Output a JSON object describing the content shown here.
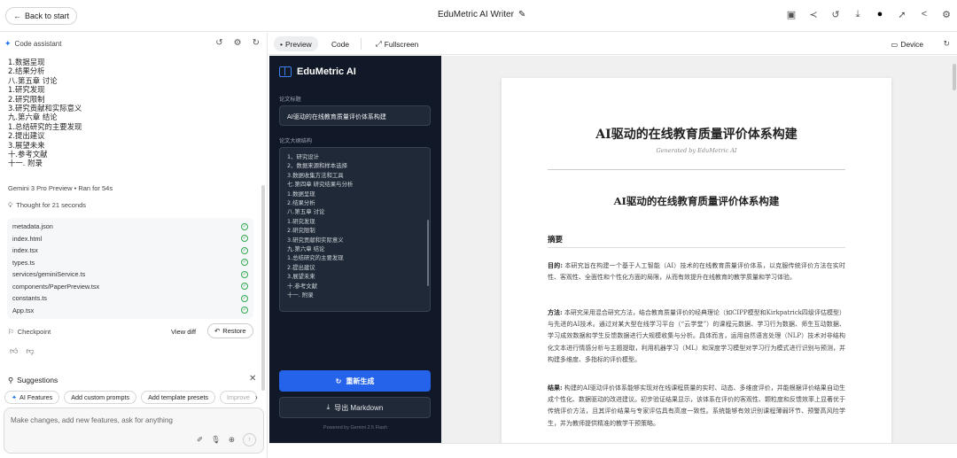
{
  "topbar": {
    "back_label": "Back to start",
    "app_title": "EduMetric AI Writer"
  },
  "assistant": {
    "header": "Code assistant",
    "outline_lines": [
      "1.数据呈现",
      "2.结果分析",
      "八.第五章 讨论",
      "1.研究发现",
      "2.研究限制",
      "3.研究贡献和实际意义",
      "九.第六章 结论",
      "1.总结研究的主要发现",
      "2.提出建议",
      "3.展望未来",
      "十.参考文献",
      "十一. 附录"
    ],
    "run_info": "Gemini 3 Pro Preview • Ran for 54s",
    "thought": "Thought for 21 seconds",
    "files": [
      "metadata.json",
      "index.html",
      "index.tsx",
      "types.ts",
      "services/geminiService.ts",
      "components/PaperPreview.tsx",
      "constants.ts",
      "App.tsx"
    ],
    "checkpoint_label": "Checkpoint",
    "view_diff_label": "View diff",
    "restore_label": "Restore",
    "suggestions_label": "Suggestions",
    "chips": [
      "AI Features",
      "Add custom prompts",
      "Add template presets",
      "Improve"
    ],
    "prompt_placeholder": "Make changes, add new features, ask for anything"
  },
  "preview_toolbar": {
    "preview_label": "Preview",
    "code_label": "Code",
    "fullscreen_label": "Fullscreen",
    "device_label": "Device"
  },
  "app": {
    "brand": "EduMetric AI",
    "title_label": "论文标题",
    "title_value": "AI驱动的在线教育质量评价体系构建",
    "outline_label": "论文大纲结构",
    "outline_lines": [
      "1、研究设计",
      "2、数据来源和样本选择",
      "3.数据收集方法和工具",
      "七.第四章 研究结果与分析",
      "1.数据呈现",
      "2.结果分析",
      "八.第五章 讨论",
      "1.研究发现",
      "2.研究限制",
      "3.研究贡献和实际意义",
      "九.第六章 结论",
      "1.总结研究的主要发现",
      "2.提出建议",
      "3.展望未来",
      "十.参考文献",
      "十一. 附录"
    ],
    "regen_label": "重新生成",
    "export_label": "导出 Markdown",
    "powered": "Powered by Gemini 2.5 Flash"
  },
  "paper": {
    "title": "AI驱动的在线教育质量评价体系构建",
    "subtitle": "Generated by EduMetric AI",
    "heading": "AI驱动的在线教育质量评价体系构建",
    "section": "摘要",
    "p1_label": "目的:",
    "p1_text": "本研究旨在构建一个基于人工智能（AI）技术的在线教育质量评价体系，以克服传统评价方法在实时性、客观性、全面性和个性化方面的局限，从而有效提升在线教育的教学质量和学习体验。",
    "p2_label": "方法:",
    "p2_text": "本研究采用混合研究方法，结合教育质量评价的经典理论（如CIPP模型和Kirkpatrick四级评估模型）与先进的AI技术。通过对某大型在线学习平台（“云学堂”）的课程元数据、学习行为数据、师生互动数据、学习成效数据和学生反馈数据进行大规模收集与分析。具体而言，运用自然语言处理（NLP）技术对非结构化文本进行情感分析与主题提取，利用机器学习（ML）和深度学习模型对学习行为模式进行识别与预测，并构建多维度、多指标的评价模型。",
    "p3_label": "结果:",
    "p3_text": "构建的AI驱动评价体系能够实现对在线课程质量的实时、动态、多维度评价，并能根据评价结果自动生成个性化、数据驱动的改进建议。初步验证结果显示，该体系在评价的客观性、颗粒度和反馈效率上显著优于传统评价方法，且其评价结果与专家评估具有高度一致性。系统能够有效识别课程薄弱环节、预警高风险学生，并为教师提供精准的教学干预策略。"
  }
}
